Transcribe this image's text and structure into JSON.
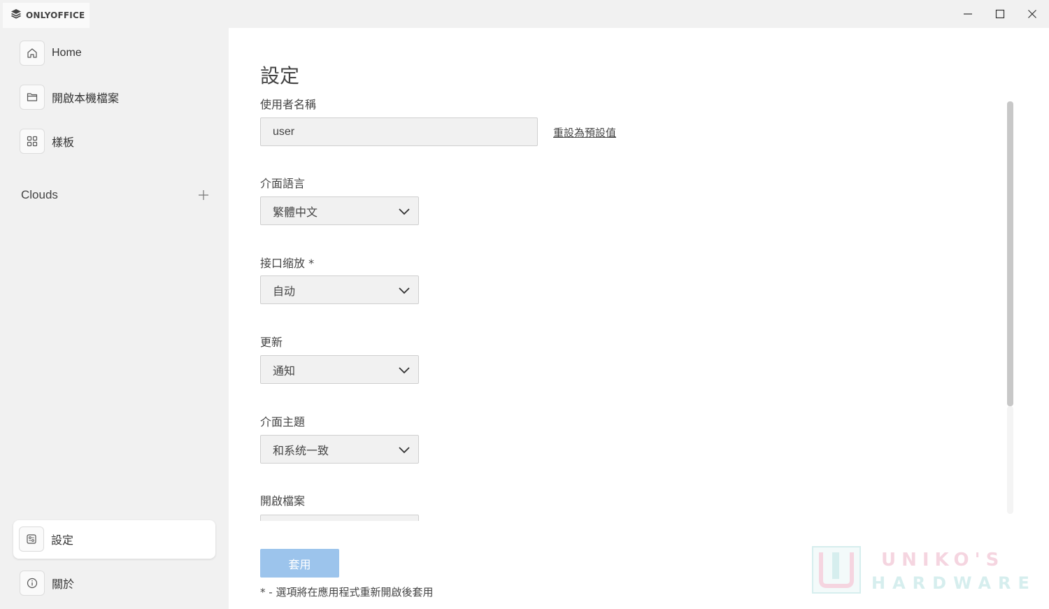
{
  "app": {
    "brand": "ONLYOFFICE"
  },
  "sidebar": {
    "items": [
      {
        "label": "Home",
        "icon": "home-icon"
      },
      {
        "label": "開啟本機檔案",
        "icon": "folder-icon"
      },
      {
        "label": "樣板",
        "icon": "grid-icon"
      }
    ],
    "clouds_label": "Clouds",
    "bottom_items": [
      {
        "label": "設定",
        "icon": "settings-icon"
      },
      {
        "label": "關於",
        "icon": "info-icon"
      }
    ]
  },
  "settings": {
    "title": "設定",
    "username_label": "使用者名稱",
    "username_value": "user",
    "reset_label": "重設為預設值",
    "language_label": "介面語言",
    "language_value": "繁體中文",
    "scaling_label": "接口缩放 *",
    "scaling_value": "自动",
    "update_label": "更新",
    "update_value": "通知",
    "theme_label": "介面主題",
    "theme_value": "和系统一致",
    "open_file_label": "開啟檔案",
    "apply_label": "套用",
    "footnote": "* - 選項將在應用程式重新開啟後套用"
  },
  "watermark": {
    "line1": "UNIKO'S",
    "line2": "HARDWARE"
  },
  "colors": {
    "accent_disabled": "#9cc4ec",
    "sidebar_bg": "#f1f1f1",
    "main_bg": "#ffffff"
  }
}
